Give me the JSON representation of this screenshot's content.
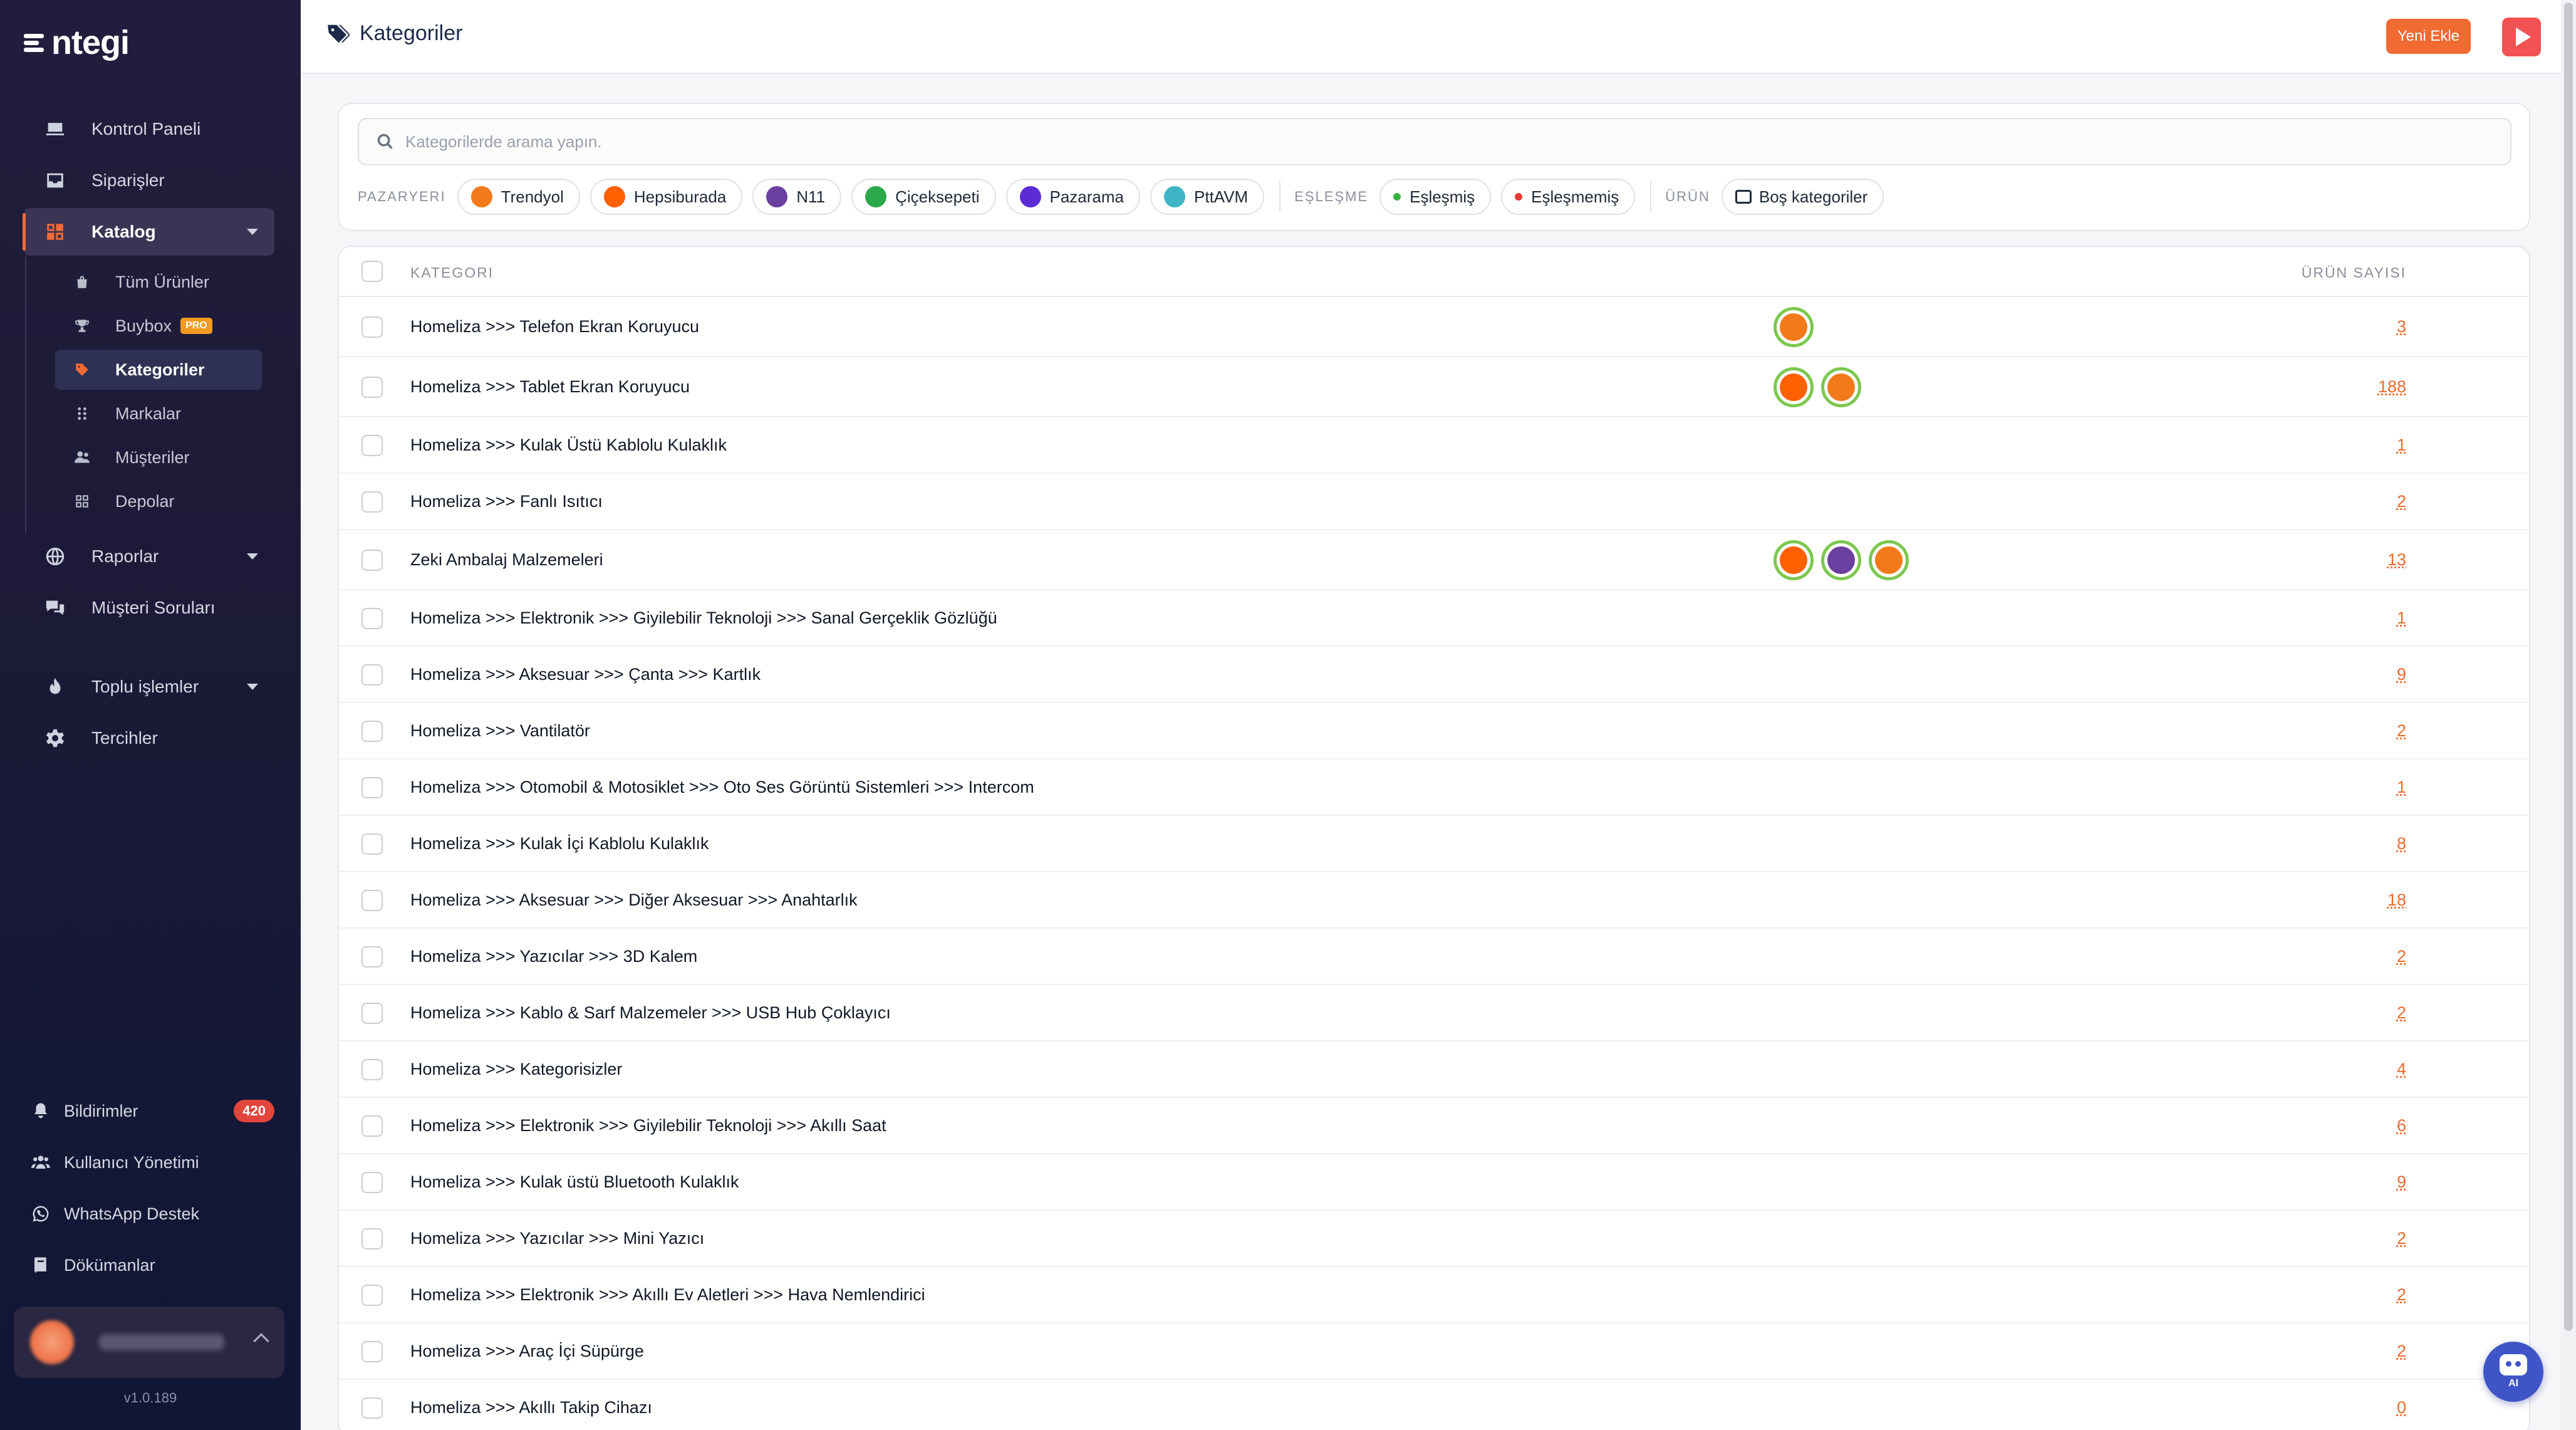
{
  "brand": {
    "name": "ntegi",
    "version": "v1.0.189"
  },
  "sidebar": {
    "main": [
      {
        "label": "Kontrol Paneli",
        "icon": "laptop-icon"
      },
      {
        "label": "Siparişler",
        "icon": "inbox-icon"
      },
      {
        "label": "Katalog",
        "icon": "grid-icon",
        "active": true,
        "expandable": true
      }
    ],
    "catalog_sub": [
      {
        "label": "Tüm Ürünler",
        "icon": "bag-icon"
      },
      {
        "label": "Buybox",
        "icon": "trophy-icon",
        "badge": "PRO"
      },
      {
        "label": "Kategoriler",
        "icon": "tag-icon",
        "active": true
      },
      {
        "label": "Markalar",
        "icon": "dots-icon"
      },
      {
        "label": "Müşteriler",
        "icon": "users-icon"
      },
      {
        "label": "Depolar",
        "icon": "warehouse-icon"
      }
    ],
    "more": [
      {
        "label": "Raporlar",
        "icon": "globe-icon",
        "expandable": true
      },
      {
        "label": "Müşteri Soruları",
        "icon": "chat-icon"
      },
      {
        "label": "Toplu işlemler",
        "icon": "fire-icon",
        "expandable": true
      },
      {
        "label": "Tercihler",
        "icon": "gear-icon"
      }
    ],
    "bottom": [
      {
        "label": "Bildirimler",
        "icon": "bell-icon",
        "badge": "420"
      },
      {
        "label": "Kullanıcı Yönetimi",
        "icon": "user-group-icon"
      },
      {
        "label": "WhatsApp Destek",
        "icon": "whatsapp-icon"
      },
      {
        "label": "Dökümanlar",
        "icon": "book-icon"
      }
    ]
  },
  "header": {
    "title": "Kategoriler",
    "new_button": "Yeni Ekle"
  },
  "search": {
    "placeholder": "Kategorilerde arama yapın."
  },
  "filters": {
    "marketplace_label": "PAZARYERI",
    "marketplaces": [
      {
        "label": "Trendyol",
        "color": "#f27a1a"
      },
      {
        "label": "Hepsiburada",
        "color": "#ff6000"
      },
      {
        "label": "N11",
        "color": "#6b3fa0"
      },
      {
        "label": "Çiçeksepeti",
        "color": "#2ba84a"
      },
      {
        "label": "Pazarama",
        "color": "#5b2bd6"
      },
      {
        "label": "PttAVM",
        "color": "#3fb6c6"
      }
    ],
    "match_label": "EŞLEŞME",
    "match": [
      {
        "label": "Eşleşmiş",
        "color": "#38b23f"
      },
      {
        "label": "Eşleşmemiş",
        "color": "#e23b35"
      }
    ],
    "product_label": "ÜRÜN",
    "product": {
      "label": "Boş kategoriler"
    }
  },
  "table": {
    "col_category": "KATEGORI",
    "col_count": "ÜRÜN SAYISI",
    "rows": [
      {
        "name": "Homeliza >>> Telefon Ekran Koruyucu",
        "count": "3",
        "markets": [
          "trendyol"
        ]
      },
      {
        "name": "Homeliza >>> Tablet Ekran Koruyucu",
        "count": "188",
        "markets": [
          "hepsiburada",
          "trendyol"
        ]
      },
      {
        "name": "Homeliza >>> Kulak Üstü Kablolu Kulaklık",
        "count": "1",
        "markets": []
      },
      {
        "name": "Homeliza >>> Fanlı Isıtıcı",
        "count": "2",
        "markets": []
      },
      {
        "name": "Zeki Ambalaj Malzemeleri",
        "count": "13",
        "markets": [
          "hepsiburada",
          "n11",
          "trendyol"
        ]
      },
      {
        "name": "Homeliza >>> Elektronik >>> Giyilebilir Teknoloji >>> Sanal Gerçeklik Gözlüğü",
        "count": "1",
        "markets": []
      },
      {
        "name": "Homeliza >>> Aksesuar >>> Çanta >>> Kartlık",
        "count": "9",
        "markets": []
      },
      {
        "name": "Homeliza >>> Vantilatör",
        "count": "2",
        "markets": []
      },
      {
        "name": "Homeliza >>> Otomobil & Motosiklet >>> Oto Ses Görüntü Sistemleri >>> Intercom",
        "count": "1",
        "markets": []
      },
      {
        "name": "Homeliza >>> Kulak İçi Kablolu Kulaklık",
        "count": "8",
        "markets": []
      },
      {
        "name": "Homeliza >>> Aksesuar >>> Diğer Aksesuar >>> Anahtarlık",
        "count": "18",
        "markets": []
      },
      {
        "name": "Homeliza >>> Yazıcılar >>> 3D Kalem",
        "count": "2",
        "markets": []
      },
      {
        "name": "Homeliza >>> Kablo & Sarf Malzemeler >>> USB Hub Çoklayıcı",
        "count": "2",
        "markets": []
      },
      {
        "name": "Homeliza >>> Kategorisizler",
        "count": "4",
        "markets": []
      },
      {
        "name": "Homeliza >>> Elektronik >>> Giyilebilir Teknoloji >>> Akıllı Saat",
        "count": "6",
        "markets": []
      },
      {
        "name": "Homeliza >>> Kulak üstü Bluetooth Kulaklık",
        "count": "9",
        "markets": []
      },
      {
        "name": "Homeliza >>> Yazıcılar >>> Mini Yazıcı",
        "count": "2",
        "markets": []
      },
      {
        "name": "Homeliza >>> Elektronik >>> Akıllı Ev Aletleri >>> Hava Nemlendirici",
        "count": "2",
        "markets": []
      },
      {
        "name": "Homeliza >>> Araç İçi Süpürge",
        "count": "2",
        "markets": []
      },
      {
        "name": "Homeliza >>> Akıllı Takip Cihazı",
        "count": "0",
        "markets": []
      }
    ]
  },
  "ai_button": {
    "label": "AI"
  }
}
